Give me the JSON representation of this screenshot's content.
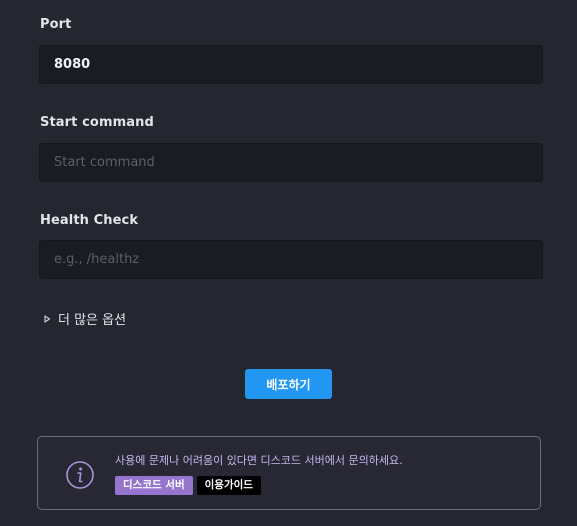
{
  "form": {
    "port": {
      "label": "Port",
      "value": "8080",
      "placeholder": ""
    },
    "start_command": {
      "label": "Start command",
      "value": "",
      "placeholder": "Start command"
    },
    "health_check": {
      "label": "Health Check",
      "value": "",
      "placeholder": "e.g., /healthz"
    },
    "more_options_label": "더 많은 옵션",
    "deploy_label": "배포하기"
  },
  "notice": {
    "message": "사용에 문제나 어려움이 있다면 디스코드 서버에서 문의하세요.",
    "discord_label": "디스코드 서버",
    "guide_label": "이용가이드",
    "icon": "info-icon"
  },
  "colors": {
    "background": "#242630",
    "input_background": "#1a1c23",
    "accent": "#2196f3",
    "notice_text": "#c8b6ee",
    "discord_badge": "#9575cd",
    "guide_badge": "#000000"
  }
}
